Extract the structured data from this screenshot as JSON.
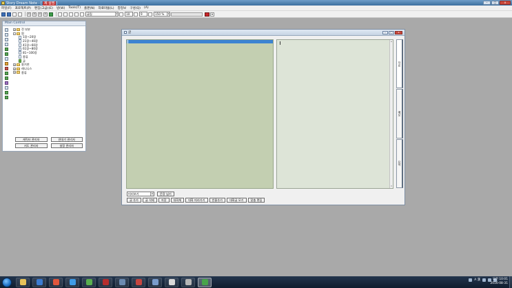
{
  "app": {
    "title": "Story Dream Note - [제 설명]",
    "title_prefix": "Story Dream Note - [",
    "title_file": "제 설명",
    "title_suffix": "]",
    "controls": {
      "minimize": "–",
      "maximize": "□",
      "close": "x"
    }
  },
  "menu": [
    "파일(F)",
    "프로젝트(P)",
    "편집(고급)(E)",
    "방(W)",
    "Tools(T)",
    "출판(N)",
    "자료마을(L)",
    "창정보",
    "구성(Q)",
    "(A)"
  ],
  "toolbar": {
    "buttons": [
      "가",
      "가",
      "가",
      "가"
    ],
    "font_name": "굴림",
    "font_size": "10",
    "spacing": "9",
    "zoom": "150 %",
    "accent_color": "#c8262b",
    "icons": [
      "new-file-icon",
      "open-icon",
      "save-icon",
      "print-icon",
      "bold-icon",
      "italic-icon",
      "underline-icon",
      "strike-icon",
      "align-left-icon",
      "align-center-icon",
      "align-right-icon",
      "justify-icon"
    ]
  },
  "main_control": {
    "header": "Main Control",
    "tree": [
      {
        "level": 1,
        "label": "전 부분",
        "type": "folder",
        "expander": "+"
      },
      {
        "level": 1,
        "label": "원",
        "type": "folder",
        "expander": "–"
      },
      {
        "level": 2,
        "label": "1장~20장",
        "type": "doc"
      },
      {
        "level": 2,
        "label": "21장~40장",
        "type": "doc"
      },
      {
        "level": 2,
        "label": "41장~60장",
        "type": "doc"
      },
      {
        "level": 2,
        "label": "61장~80장",
        "type": "doc"
      },
      {
        "level": 2,
        "label": "81~100장",
        "type": "doc"
      },
      {
        "level": 2,
        "label": "종류",
        "type": "doc"
      },
      {
        "level": 2,
        "label": "글",
        "type": "doc-green"
      },
      {
        "level": 1,
        "label": "용기연",
        "type": "folder",
        "expander": "+"
      },
      {
        "level": 1,
        "label": "레니니스",
        "type": "folder",
        "expander": "+"
      },
      {
        "level": 1,
        "label": "종류",
        "type": "folder",
        "expander": "+"
      }
    ],
    "buttons": [
      "캐릭터 관리자",
      "연대기 관리자",
      "지도 관리자",
      "설정 관리자"
    ]
  },
  "document": {
    "title": "글",
    "side_tabs": [
      "자료",
      "메모",
      "요약"
    ],
    "view_select": "미리보기",
    "controls_row1": {
      "auto_button": "문장 넘기"
    },
    "controls_row2": [
      "글 추가",
      "글 삭제",
      "저장",
      "대화체",
      "대화 따라가기",
      "빈줄추가",
      "대화글 모기",
      "맞춤 편집"
    ]
  },
  "taskbar": {
    "apps": [
      {
        "name": "file-explorer",
        "color": "#e7c35a"
      },
      {
        "name": "media-player",
        "color": "#3b7bd1"
      },
      {
        "name": "chrome-browser",
        "color": "#e0563c"
      },
      {
        "name": "internet-explorer",
        "color": "#3f9be6"
      },
      {
        "name": "chrome-2",
        "color": "#5aaf4f"
      },
      {
        "name": "headset",
        "color": "#b52d2d"
      },
      {
        "name": "steam",
        "color": "#6b8ab0"
      },
      {
        "name": "news-reader",
        "color": "#c64640"
      },
      {
        "name": "screen-tool",
        "color": "#7a9ccc"
      },
      {
        "name": "utility-disc",
        "color": "#d9d9d9"
      },
      {
        "name": "game-controller",
        "color": "#b6b6b6"
      },
      {
        "name": "story-dream-note",
        "color": "#48a44a",
        "active": true
      }
    ],
    "tray": {
      "ime": "A 漢",
      "time": "오전 10:01",
      "date": "2016-08-31"
    }
  }
}
